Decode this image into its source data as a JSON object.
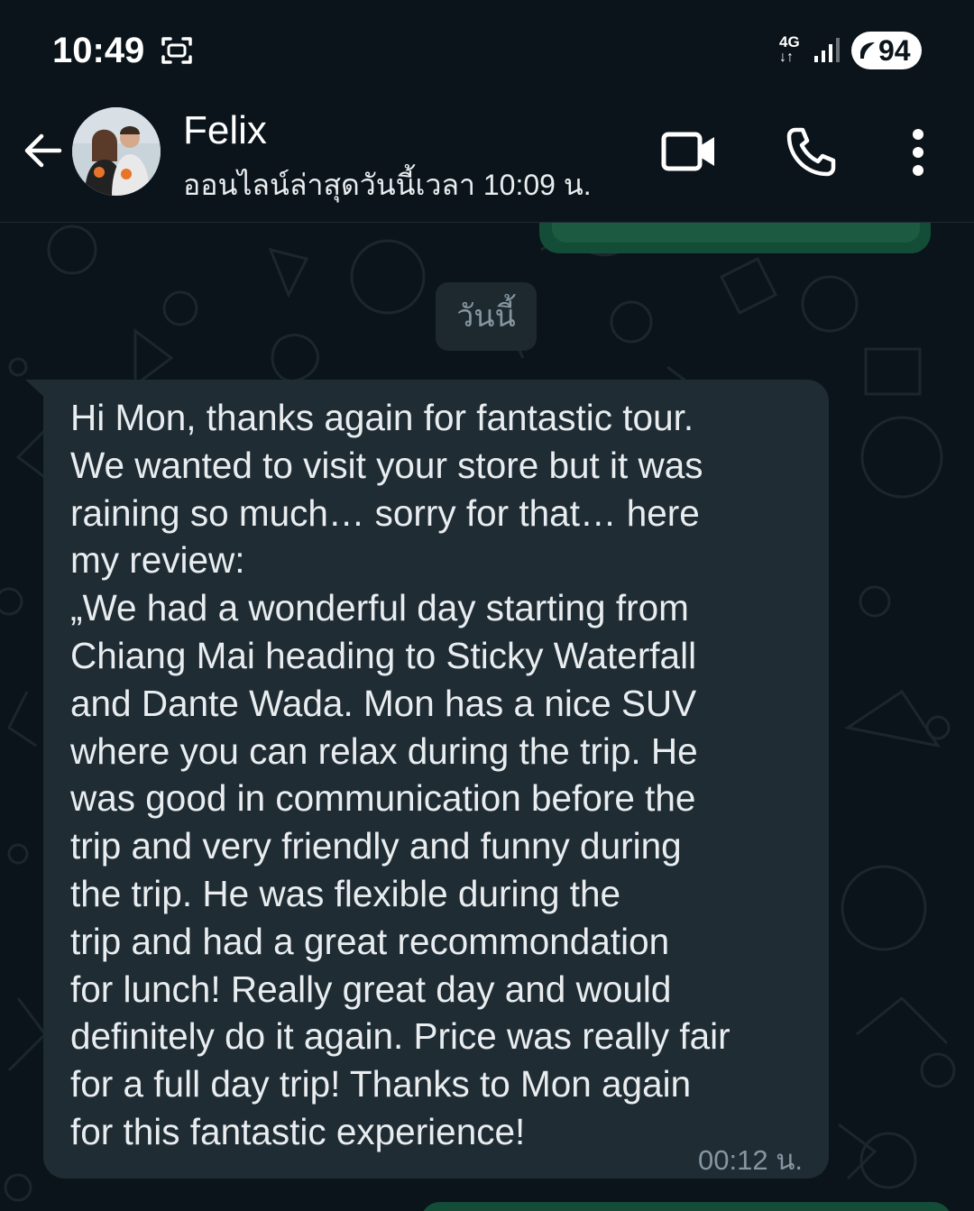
{
  "status_bar": {
    "time": "10:49",
    "network": "4G",
    "battery": "94"
  },
  "header": {
    "contact_name": "Felix",
    "last_seen": "ออนไลน์ล่าสุดวันนี้เวลา 10:09 น.",
    "icons": [
      "back-arrow-icon",
      "video-call-icon",
      "voice-call-icon",
      "more-options-icon"
    ]
  },
  "chat": {
    "date_divider": "วันนี้",
    "message": {
      "text": "Hi Mon, thanks again for fantastic tour.\nWe wanted to visit your store but it was\nraining so much… sorry for that… here\nmy review:\n„We had a wonderful day starting from\nChiang Mai heading to Sticky Waterfall\nand Dante Wada. Mon has a nice SUV\nwhere you can relax during the trip. He\nwas good in communication before the\ntrip and very friendly and funny during\nthe trip. He was flexible during the\ntrip and had a great recommondation\nfor lunch! Really great day and would\ndefinitely do it again. Price was really fair\nfor a full day trip! Thanks to Mon again\nfor this fantastic experience!",
      "time": "00:12 น."
    }
  },
  "colors": {
    "background": "#0b141a",
    "incoming_bubble": "#1f2c34",
    "outgoing_bubble": "#144d37",
    "secondary_text": "#8696a0"
  }
}
